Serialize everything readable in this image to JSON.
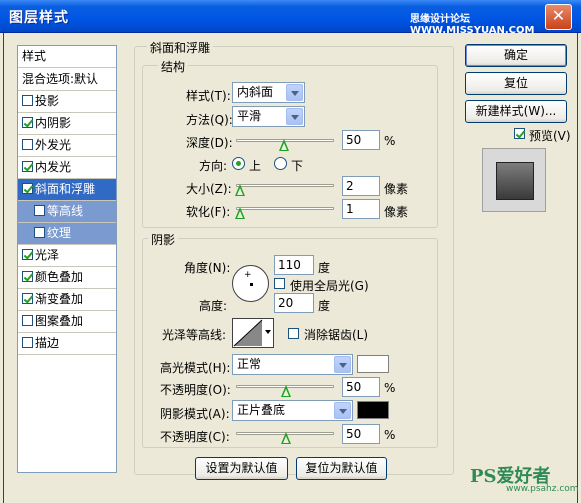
{
  "window": {
    "title": "图层样式",
    "watermark": "思缘设计论坛 WWW.MISSYUAN.COM",
    "close_glyph": "✕"
  },
  "sidebar": {
    "items": [
      {
        "label": "样式",
        "checkbox": false,
        "checked": false
      },
      {
        "label": "混合选项:默认",
        "checkbox": false,
        "checked": false
      },
      {
        "label": "投影",
        "checkbox": true,
        "checked": false
      },
      {
        "label": "内阴影",
        "checkbox": true,
        "checked": true
      },
      {
        "label": "外发光",
        "checkbox": true,
        "checked": false
      },
      {
        "label": "内发光",
        "checkbox": true,
        "checked": true
      },
      {
        "label": "斜面和浮雕",
        "checkbox": true,
        "checked": true,
        "selected": true
      },
      {
        "label": "等高线",
        "checkbox": true,
        "checked": false,
        "sub": true
      },
      {
        "label": "纹理",
        "checkbox": true,
        "checked": false,
        "sub": true
      },
      {
        "label": "光泽",
        "checkbox": true,
        "checked": true
      },
      {
        "label": "颜色叠加",
        "checkbox": true,
        "checked": true
      },
      {
        "label": "渐变叠加",
        "checkbox": true,
        "checked": true
      },
      {
        "label": "图案叠加",
        "checkbox": true,
        "checked": false
      },
      {
        "label": "描边",
        "checkbox": true,
        "checked": false
      }
    ]
  },
  "bevel": {
    "group_title": "斜面和浮雕",
    "structure_title": "结构",
    "style_label": "样式(T):",
    "style_value": "内斜面",
    "technique_label": "方法(Q):",
    "technique_value": "平滑",
    "depth_label": "深度(D):",
    "depth_value": "50",
    "depth_unit": "%",
    "depth_level": 0.5,
    "direction_label": "方向:",
    "dir_up": "上",
    "dir_down": "下",
    "size_label": "大小(Z):",
    "size_value": "2",
    "size_unit": "像素",
    "soften_label": "软化(F):",
    "soften_value": "1",
    "soften_unit": "像素"
  },
  "shading": {
    "title": "阴影",
    "angle_label": "角度(N):",
    "angle_value": "110",
    "angle_unit": "度",
    "global_light_label": "使用全局光(G)",
    "altitude_label": "高度:",
    "altitude_value": "20",
    "altitude_unit": "度",
    "gloss_label": "光泽等高线:",
    "antialias_label": "消除锯齿(L)",
    "highlight_mode_label": "高光模式(H):",
    "highlight_mode_value": "正常",
    "highlight_color": "#ffffff",
    "highlight_opacity_label": "不透明度(O):",
    "highlight_opacity_value": "50",
    "highlight_opacity_unit": "%",
    "shadow_mode_label": "阴影模式(A):",
    "shadow_mode_value": "正片叠底",
    "shadow_color": "#000000",
    "shadow_opacity_label": "不透明度(C):",
    "shadow_opacity_value": "50",
    "shadow_opacity_unit": "%"
  },
  "footer": {
    "make_default": "设置为默认值",
    "reset_default": "复位为默认值"
  },
  "actions": {
    "ok": "确定",
    "reset": "复位",
    "new_style": "新建样式(W)...",
    "preview_label": "预览(V)"
  },
  "logo": {
    "text": "PS爱好者",
    "url": "www.psahz.com"
  }
}
